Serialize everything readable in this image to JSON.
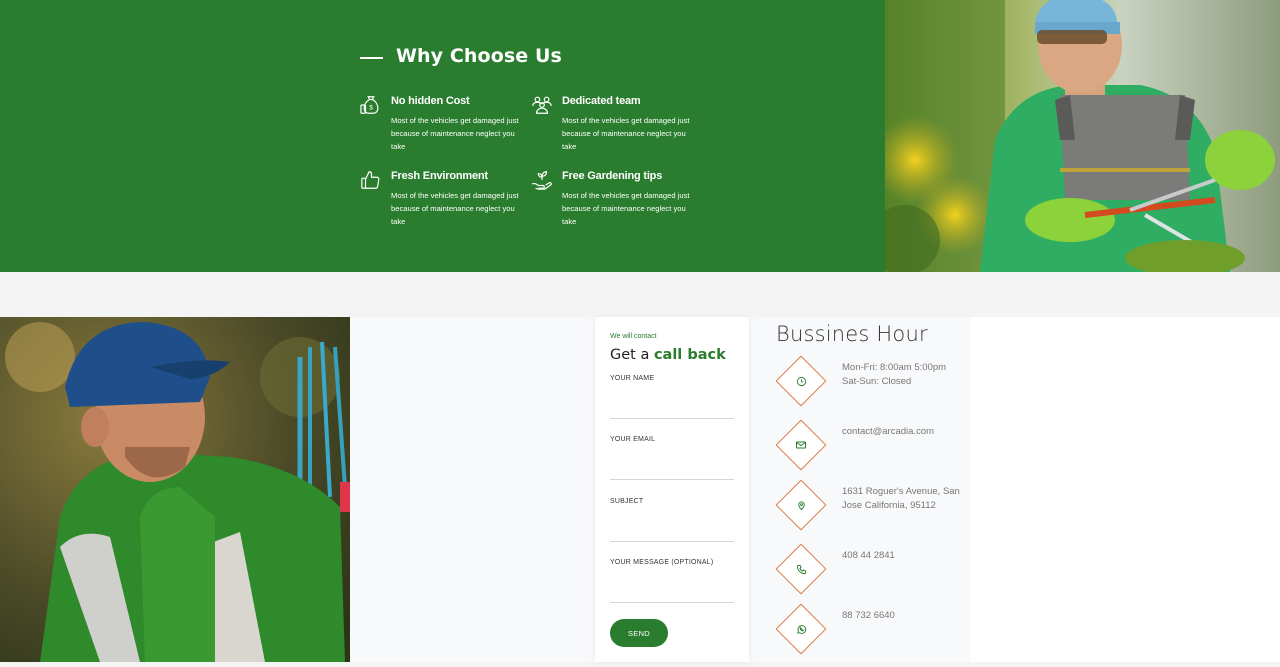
{
  "why": {
    "title": "Why Choose Us",
    "features": [
      {
        "icon": "money-bag-icon",
        "title": "No hidden Cost",
        "desc": "Most of the vehicles get damaged just because of maintenance neglect you take"
      },
      {
        "icon": "team-icon",
        "title": "Dedicated team",
        "desc": "Most of the vehicles get damaged just because of maintenance neglect you take"
      },
      {
        "icon": "thumbs-up-icon",
        "title": "Fresh Environment",
        "desc": "Most of the vehicles get damaged just because of maintenance neglect you take"
      },
      {
        "icon": "hand-plant-icon",
        "title": "Free Gardening tips",
        "desc": "Most of the vehicles get damaged just because of maintenance neglect you take"
      }
    ]
  },
  "callback": {
    "eyebrow": "We will contact",
    "heading_prefix": "Get a ",
    "heading_accent": "call back",
    "fields": [
      {
        "label": "YOUR NAME",
        "value": ""
      },
      {
        "label": "YOUR EMAIL",
        "value": ""
      },
      {
        "label": "SUBJECT",
        "value": ""
      },
      {
        "label": "YOUR MESSAGE (OPTIONAL)",
        "value": ""
      }
    ],
    "send_label": "SEND"
  },
  "hours": {
    "title": "Bussines Hour",
    "items": [
      {
        "icon": "clock-icon",
        "text": "Mon-Fri: 8:00am 5:00pm Sat-Sun: Closed"
      },
      {
        "icon": "email-icon",
        "text": "contact@arcadia.com"
      },
      {
        "icon": "location-pin-icon",
        "text": "1631 Roguer's Avenue, San Jose California, 95112"
      },
      {
        "icon": "phone-icon",
        "text": "408 44 2841"
      },
      {
        "icon": "whatsapp-icon",
        "text": "88 732 6640"
      }
    ]
  },
  "colors": {
    "brand_green": "#2a7d2e",
    "accent_orange": "#e07a4d"
  }
}
